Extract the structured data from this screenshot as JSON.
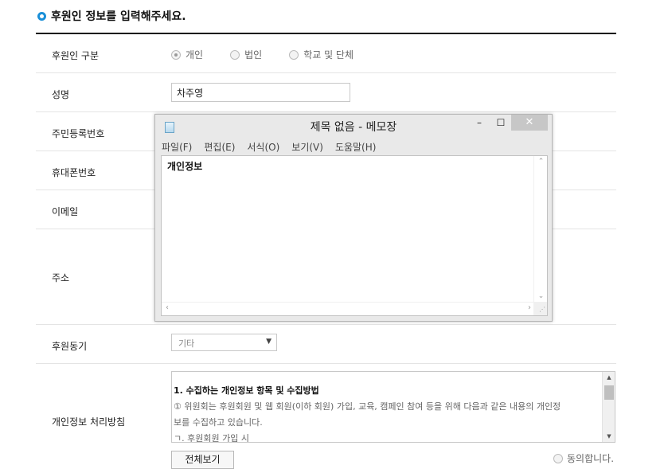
{
  "section": {
    "title": "후원인 정보를 입력해주세요."
  },
  "form": {
    "sponsor_type": {
      "label": "후원인 구분",
      "options": [
        "개인",
        "법인",
        "학교 및 단체"
      ],
      "selected": "개인"
    },
    "name": {
      "label": "성명",
      "value": "차주영"
    },
    "resident_number": {
      "label": "주민등록번호"
    },
    "mobile": {
      "label": "휴대폰번호"
    },
    "email": {
      "label": "이메일"
    },
    "address": {
      "label": "주소"
    },
    "motive": {
      "label": "후원동기",
      "selected": "기타"
    },
    "privacy": {
      "label": "개인정보 처리방침",
      "heading": "1. 수집하는 개인정보 항목 및 수집방법",
      "line1": "① 위원회는 후원회원 및 웹 회원(이하 회원) 가입, 교육, 캠페인 참여 등을 위해 다음과 같은 내용의 개인정",
      "line2": "보를 수집하고 있습니다.",
      "line3": "ㄱ. 후원회원 가입 시",
      "view_all_button": "전체보기",
      "agree_label": "동의합니다."
    }
  },
  "notepad": {
    "title": "제목 없음 - 메모장",
    "menu": [
      "파일(F)",
      "편집(E)",
      "서식(O)",
      "보기(V)",
      "도움말(H)"
    ],
    "content": "개인정보"
  }
}
